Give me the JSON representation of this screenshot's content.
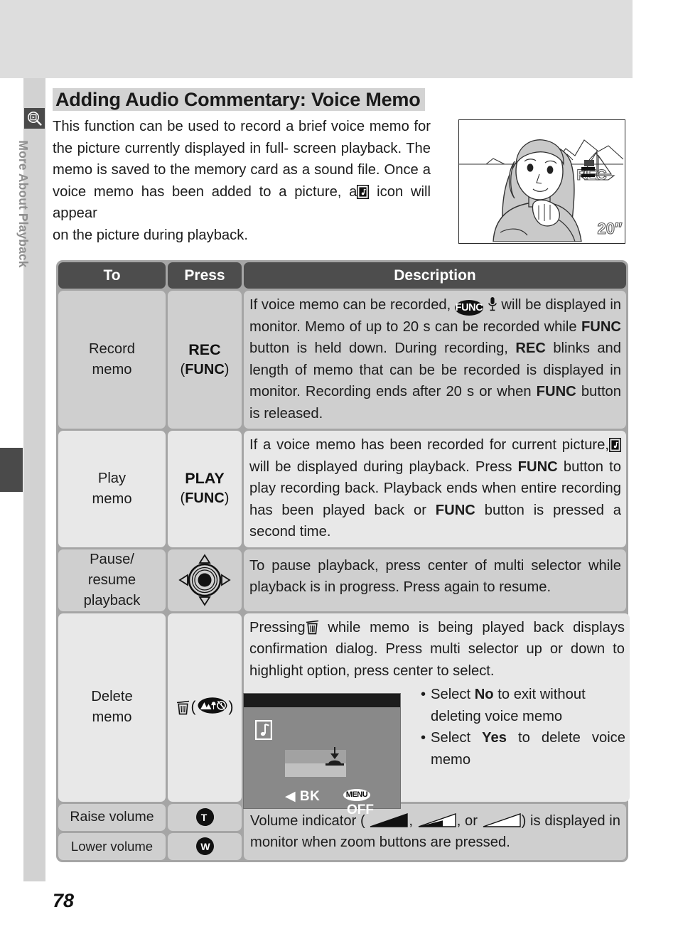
{
  "sidebar": {
    "icon": "playback-magnifier-icon",
    "label": "More About Playback"
  },
  "header": {
    "title": "Adding Audio Commentary: Voice Memo"
  },
  "intro": {
    "line1": "This function can be used to record a brief voice",
    "line2": "memo for the picture currently displayed in full-",
    "line3": "screen playback.  The memo is saved to the",
    "line4": "memory card as a sound file.  Once a voice memo",
    "line5a": "has been added to a picture, a",
    "line5b": "icon will appear",
    "line6": "on the picture during playback."
  },
  "illustration": {
    "rec_label": "REC",
    "duration_label": "20″",
    "alt": "camera-monitor-voice-memo-recording"
  },
  "table": {
    "headers": {
      "to": "To",
      "press": "Press",
      "description": "Description"
    },
    "rows": [
      {
        "to": "Record\nmemo",
        "to_line1": "Record",
        "to_line2": "memo",
        "press_main": "REC",
        "press_sub": "(FUNC)",
        "desc_a": "If voice memo can be recorded,",
        "desc_func_badge": "FUNC",
        "desc_b": "will be displayed in monitor.  Memo of up to 20 s can be recorded while",
        "desc_bold1": "FUNC",
        "desc_c": "button is held down.  During recording,",
        "desc_bold2": "REC",
        "desc_d": "blinks and length of memo that can be be recorded is displayed in monitor.  Recording ends after 20 s or when",
        "desc_bold3": "FUNC",
        "desc_e": "button is released."
      },
      {
        "to_line1": "Play",
        "to_line2": "memo",
        "press_main": "PLAY",
        "press_sub": "(FUNC)",
        "desc_a": "If a voice memo has been recorded for current picture,",
        "desc_b": "will be displayed during playback.  Press",
        "desc_bold1": "FUNC",
        "desc_c": "button to play recording back.  Playback ends when entire recording has been played back or",
        "desc_bold2": "FUNC",
        "desc_d": "button is pressed a second time."
      },
      {
        "to_line1": "Pause/",
        "to_line2": "resume",
        "to_line3": "playback",
        "press_icon": "multi-selector-icon",
        "desc_a": "To pause playback, press center of multi selector while playback is in progress.  Press again to resume."
      },
      {
        "to_line1": "Delete",
        "to_line2": "memo",
        "press_icon": "trash-icon",
        "press_paren_open": "(",
        "press_badge": "scene-mode-icon",
        "press_paren_close": ")",
        "desc_a": "Pressing",
        "desc_trash": "trash-icon",
        "desc_b": "while memo is being played back displays confirmation dialog.  Press multi selector up or down to highlight option, press center to select.",
        "bullets": [
          {
            "pre": "Select",
            "bold": "No",
            "post": "to exit without deleting voice memo"
          },
          {
            "pre": "Select",
            "bold": "Yes",
            "post": "to delete voice memo"
          }
        ],
        "monitor": {
          "memo_icon": "voice-memo-icon",
          "back_arrow": "◀",
          "back_label": "BK",
          "menu_badge": "MENU",
          "menu_label": "OFF"
        }
      }
    ],
    "volume_rows": [
      {
        "label": "Raise volume",
        "key": "T"
      },
      {
        "label": "Lower volume",
        "key": "W"
      }
    ],
    "volume_desc": {
      "a": "Volume indicator (",
      "icon1": "volume-full-icon",
      "sep1": ",",
      "icon2": "volume-half-icon",
      "sep2": ", or",
      "icon3": "volume-empty-icon",
      "b": ") is displayed in monitor when zoom buttons are pressed."
    }
  },
  "footer": {
    "page_number": "78"
  },
  "colors": {
    "band": "#dddddd",
    "table_gutter": "#a5a5a5",
    "header_bg": "#4d4d4d",
    "cell_dark": "#cfcfcf",
    "cell_light": "#e8e8e8",
    "sidebar_text": "#8f8f8f",
    "monitor_bg": "#898989"
  }
}
